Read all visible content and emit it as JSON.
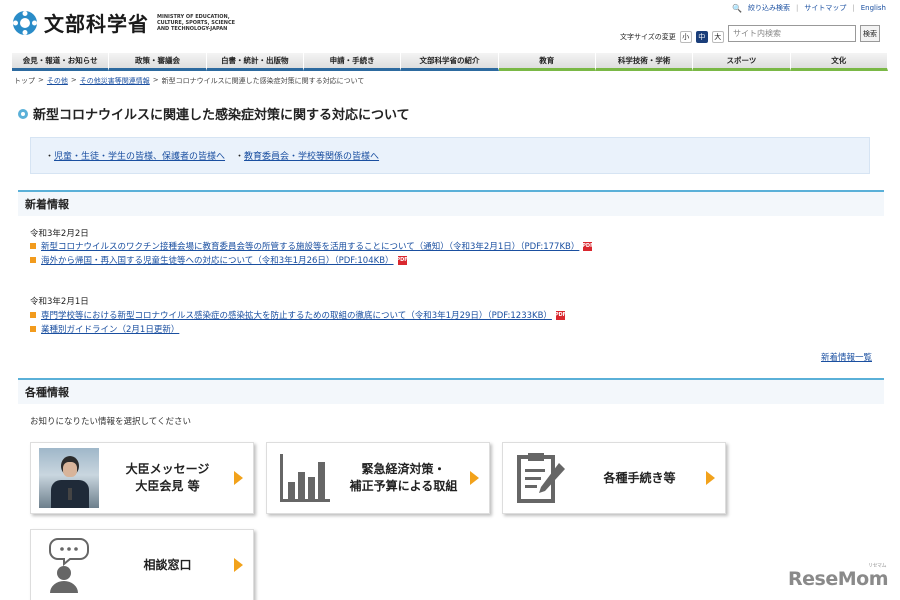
{
  "header": {
    "logo_text": "文部科学省",
    "logo_sub": "MINISTRY OF EDUCATION, CULTURE, SPORTS, SCIENCE AND TECHNOLOGY-JAPAN",
    "util_links": [
      "絞り込み検索",
      "サイトマップ",
      "English"
    ],
    "font_size_label": "文字サイズの変更",
    "font_sizes": [
      "小",
      "中",
      "大"
    ],
    "search_placeholder": "サイト内検索",
    "search_button": "検索"
  },
  "gnav": [
    "会見・報道・お知らせ",
    "政策・審議会",
    "白書・統計・出版物",
    "申請・手続き",
    "文部科学省の紹介",
    "教育",
    "科学技術・学術",
    "スポーツ",
    "文化"
  ],
  "breadcrumb": [
    "トップ",
    ">",
    "その他",
    ">",
    "その他災害等関連情報",
    ">",
    "新型コロナウイルスに関連した感染症対策に関する対応について"
  ],
  "page_title": "新型コロナウイルスに関連した感染症対策に関する対応について",
  "quick_links": [
    "児童・生徒・学生の皆様、保護者の皆様へ",
    "教育委員会・学校等関係の皆様へ"
  ],
  "news": {
    "heading": "新着情報",
    "groups": [
      {
        "date": "令和3年2月2日",
        "items": [
          "新型コロナウイルスのワクチン接種会場に教育委員会等の所管する施設等を活用することについて（通知）（令和3年2月1日）（PDF:177KB）",
          "海外から帰国・再入国する児童生徒等への対応について（令和3年1月26日）（PDF:104KB）"
        ]
      },
      {
        "date": "令和3年2月1日",
        "items": [
          "専門学校等における新型コロナウイルス感染症の感染拡大を防止するための取組の徹底について（令和3年1月29日）（PDF:1233KB）",
          "業種別ガイドライン（2月1日更新）"
        ]
      }
    ],
    "all_link": "新着情報一覧"
  },
  "info": {
    "heading": "各種情報",
    "intro": "お知りになりたい情報を選択してください",
    "cards": [
      {
        "label": "大臣メッセージ\n大臣会見 等",
        "icon": "minister-photo"
      },
      {
        "label": "緊急経済対策・\n補正予算による取組",
        "icon": "bar-chart-icon"
      },
      {
        "label": "各種手続き等",
        "icon": "clipboard-icon"
      },
      {
        "label": "相談窓口",
        "icon": "consultation-icon"
      }
    ]
  },
  "watermark": "ReseMom",
  "watermark_sub": "リセマム",
  "colors": {
    "accent_blue": "#5ab0d8",
    "nav_blue": "#2d6a9f",
    "nav_green": "#7ab846",
    "arrow_orange": "#f2a21b",
    "link": "#1a4fa0"
  }
}
